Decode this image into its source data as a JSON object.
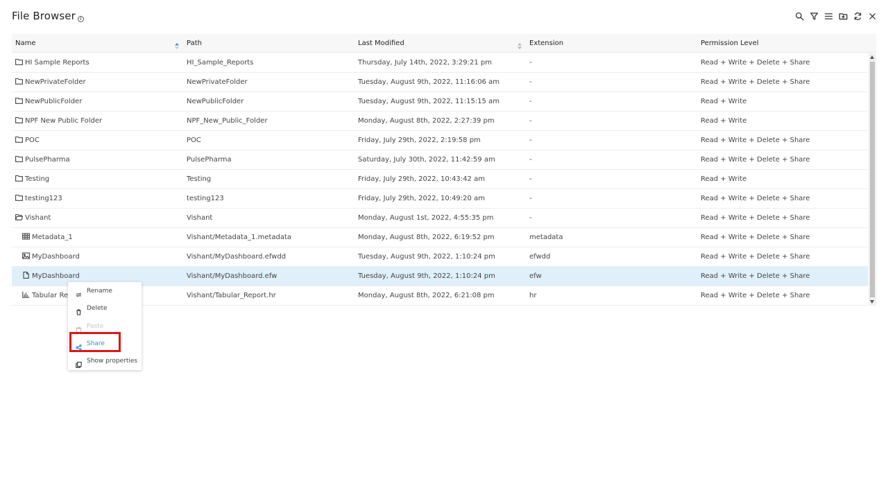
{
  "header": {
    "title": "File Browser",
    "info_glyph": "i",
    "toolbar": [
      {
        "name": "search-icon"
      },
      {
        "name": "filter-icon"
      },
      {
        "name": "list-menu-icon"
      },
      {
        "name": "new-folder-icon"
      },
      {
        "name": "refresh-icon"
      },
      {
        "name": "close-icon"
      }
    ]
  },
  "table": {
    "columns": {
      "name": "Name",
      "path": "Path",
      "modified": "Last Modified",
      "extension": "Extension",
      "permission": "Permission Level"
    },
    "rows": [
      {
        "icon": "folder-icon",
        "name": "HI Sample Reports",
        "path": "HI_Sample_Reports",
        "modified": "Thursday, July 14th, 2022, 3:29:21 pm",
        "ext": "-",
        "perm": "Read + Write + Delete + Share"
      },
      {
        "icon": "folder-icon",
        "name": "NewPrivateFolder",
        "path": "NewPrivateFolder",
        "modified": "Tuesday, August 9th, 2022, 11:16:06 am",
        "ext": "-",
        "perm": "Read + Write + Delete + Share"
      },
      {
        "icon": "folder-icon",
        "name": "NewPublicFolder",
        "path": "NewPublicFolder",
        "modified": "Tuesday, August 9th, 2022, 11:15:15 am",
        "ext": "-",
        "perm": "Read + Write"
      },
      {
        "icon": "folder-icon",
        "name": "NPF New Public Folder",
        "path": "NPF_New_Public_Folder",
        "modified": "Monday, August 8th, 2022, 2:27:39 pm",
        "ext": "-",
        "perm": "Read + Write"
      },
      {
        "icon": "folder-icon",
        "name": "POC",
        "path": "POC",
        "modified": "Friday, July 29th, 2022, 2:19:58 pm",
        "ext": "-",
        "perm": "Read + Write + Delete + Share"
      },
      {
        "icon": "folder-icon",
        "name": "PulsePharma",
        "path": "PulsePharma",
        "modified": "Saturday, July 30th, 2022, 11:42:59 am",
        "ext": "-",
        "perm": "Read + Write + Delete + Share"
      },
      {
        "icon": "folder-icon",
        "name": "Testing",
        "path": "Testing",
        "modified": "Friday, July 29th, 2022, 10:43:42 am",
        "ext": "-",
        "perm": "Read + Write"
      },
      {
        "icon": "folder-icon",
        "name": "testing123",
        "path": "testing123",
        "modified": "Friday, July 29th, 2022, 10:49:20 am",
        "ext": "-",
        "perm": "Read + Write + Delete + Share"
      },
      {
        "icon": "folder-open-icon",
        "name": "Vishant",
        "path": "Vishant",
        "modified": "Monday, August 1st, 2022, 4:55:35 pm",
        "ext": "-",
        "perm": "Read + Write + Delete + Share"
      },
      {
        "icon": "table-grid-icon",
        "name": "Metadata_1",
        "path": "Vishant/Metadata_1.metadata",
        "modified": "Monday, August 8th, 2022, 6:19:52 pm",
        "ext": "metadata",
        "perm": "Read + Write + Delete + Share"
      },
      {
        "icon": "image-file-icon",
        "name": "MyDashboard",
        "path": "Vishant/MyDashboard.efwdd",
        "modified": "Tuesday, August 9th, 2022, 1:10:24 pm",
        "ext": "efwdd",
        "perm": "Read + Write + Delete + Share"
      },
      {
        "icon": "document-icon",
        "name": "MyDashboard",
        "path": "Vishant/MyDashboard.efw",
        "modified": "Tuesday, August 9th, 2022, 1:10:24 pm",
        "ext": "efw",
        "perm": "Read + Write + Delete + Share"
      },
      {
        "icon": "bar-chart-icon",
        "name": "Tabular Report",
        "path": "Vishant/Tabular_Report.hr",
        "modified": "Monday, August 8th, 2022, 6:21:08 pm",
        "ext": "hr",
        "perm": "Read + Write + Delete + Share"
      }
    ]
  },
  "context_menu": {
    "items": [
      {
        "icon": "rename-icon",
        "label": "Rename"
      },
      {
        "icon": "trash-icon",
        "label": "Delete"
      },
      {
        "icon": "paste-icon",
        "label": "Paste"
      },
      {
        "icon": "share-icon",
        "label": "Share"
      },
      {
        "icon": "properties-icon",
        "label": "Show properties"
      }
    ]
  },
  "colors": {
    "selected_row": "#dff0fa",
    "share_accent": "#2f8fc9",
    "highlight_box": "#e01515"
  }
}
